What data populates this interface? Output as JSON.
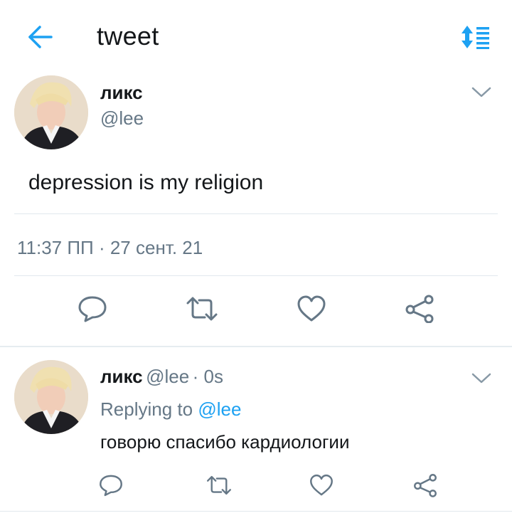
{
  "header": {
    "title": "tweet",
    "back_icon": "arrow-left-icon",
    "sort_icon": "sort-icon",
    "accent_color": "#1da1f2"
  },
  "main_tweet": {
    "display_name": "ликс",
    "handle": "@lee",
    "text": "depression is my religion",
    "timestamp": "11:37 ПП · 27 сент. 21"
  },
  "actions": [
    {
      "name": "reply",
      "icon": "reply-icon"
    },
    {
      "name": "retweet",
      "icon": "retweet-icon"
    },
    {
      "name": "like",
      "icon": "heart-icon"
    },
    {
      "name": "share",
      "icon": "share-icon"
    }
  ],
  "reply_tweet": {
    "display_name": "ликс",
    "handle": "@lee",
    "time_ago": "· 0s",
    "replying_to_label": "Replying to",
    "replying_to_handle": "@lee",
    "text": "говорю спасибо кардиологии"
  },
  "colors": {
    "text": "#14171a",
    "secondary": "#657786",
    "divider": "#e1e8ed",
    "link": "#1da1f2"
  }
}
